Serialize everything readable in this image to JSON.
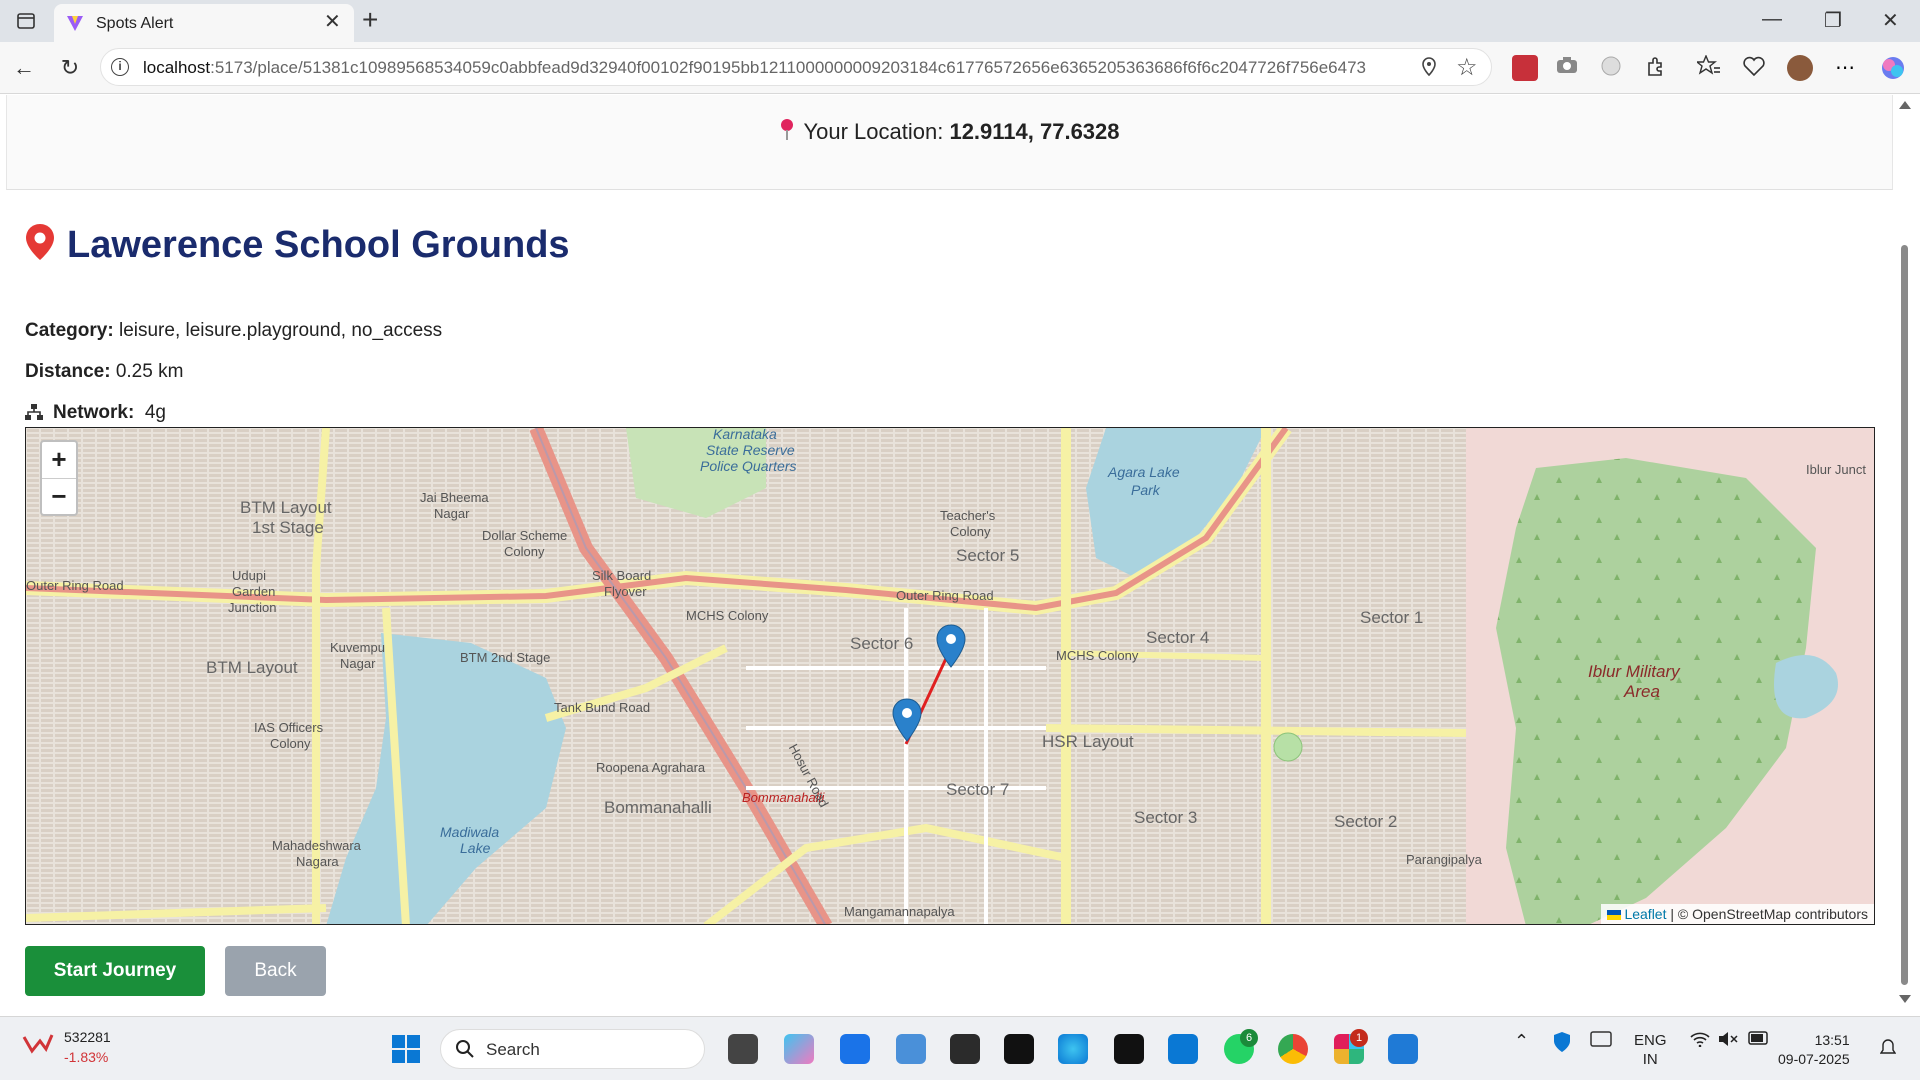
{
  "browser": {
    "tab_title": "Spots Alert",
    "url_host": "localhost",
    "url_path": ":5173/place/51381c10989568534059c0abbfead9d32940f00102f90195bb1211000000009203184c61776572656e6365205363686f6f6c2047726f756e6473"
  },
  "location": {
    "label": "Your Location:",
    "coords": "12.9114, 77.6328"
  },
  "place": {
    "name": "Lawerence School Grounds",
    "category_label": "Category:",
    "category_value": "leisure, leisure.playground, no_access",
    "distance_label": "Distance:",
    "distance_value": "0.25 km",
    "network_label": "Network:",
    "network_value": "4g"
  },
  "map": {
    "zoom_in": "+",
    "zoom_out": "−",
    "attribution_link": "Leaflet",
    "attribution_rest": "| © OpenStreetMap contributors",
    "labels": {
      "karnataka": "Karnataka",
      "karnataka2": "State Reserve",
      "karnataka3": "Police Quarters",
      "agara": "Agara Lake",
      "agara2": "Park",
      "btm1": "BTM Layout",
      "btm1b": "1st Stage",
      "btm": "BTM Layout",
      "btm2": "BTM 2nd Stage",
      "silk": "Silk Board",
      "silk2": "Flyover",
      "outer_ring": "Outer Ring Road",
      "outer_ring2": "Outer Ring Road",
      "mchs1": "MCHS Colony",
      "mchs2": "MCHS Colony",
      "sector6": "Sector 6",
      "sector5": "Sector 5",
      "sector4": "Sector 4",
      "sector7": "Sector 7",
      "sector3": "Sector 3",
      "sector2": "Sector 2",
      "sector1": "Sector 1",
      "hsr": "HSR Layout",
      "iblur": "Iblur Military",
      "iblur2": "Area",
      "madiwala": "Madiwala",
      "madiwala2": "Lake",
      "roopena": "Roopena Agrahara",
      "bommanahalli": "Bommanahalli",
      "bommanahalli2": "Bommanahalli",
      "mangamman": "Mangamannapalya",
      "parangipalya": "Parangipalya",
      "mahadeshwara": "Mahadeshwara",
      "mahadeshwara2": "Nagara",
      "ias": "IAS Officers",
      "ias2": "Colony",
      "kuvempu": "Kuvempu",
      "kuvempu2": "Nagar",
      "udupi": "Udupi",
      "udupi2": "Garden",
      "udupi3": "Junction",
      "jai": "Jai Bheema",
      "jai2": "Nagar",
      "dollar": "Dollar Scheme",
      "dollar2": "Colony",
      "teacher": "Teacher's",
      "teacher2": "Colony",
      "tank": "Tank Bund Road",
      "hosur": "Hosur Road",
      "iblur_junc": "Iblur Junct"
    }
  },
  "buttons": {
    "start": "Start Journey",
    "back": "Back"
  },
  "taskbar": {
    "stock_value": "532281",
    "stock_change": "-1.83%",
    "search_label": "Search",
    "lang": "ENG",
    "region": "IN",
    "time": "13:51",
    "date": "09-07-2025",
    "whatsapp_badge": "6",
    "slack_badge": "1"
  },
  "colors": {
    "title": "#1a2b6d",
    "start_button": "#1a8f3a",
    "back_button": "#9aa3ad",
    "route": "#e02020",
    "marker": "#2a81cb"
  }
}
